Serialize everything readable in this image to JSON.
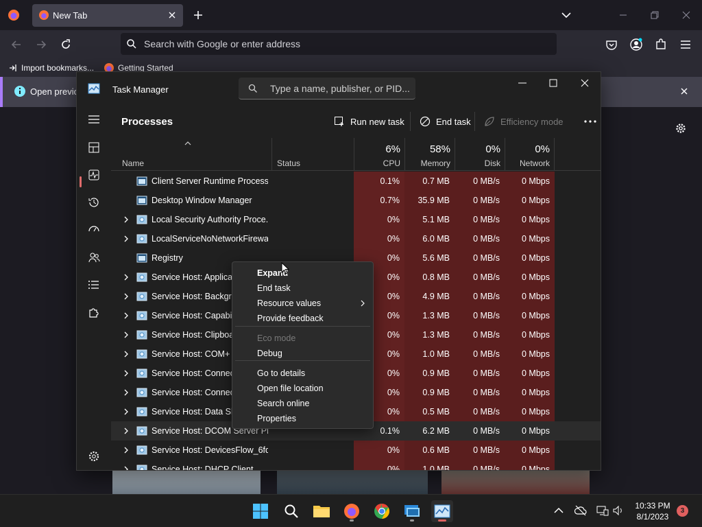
{
  "browser": {
    "tab_title": "New Tab",
    "url_placeholder": "Search with Google or enter address",
    "bookmarks": [
      {
        "label": "Import bookmarks..."
      },
      {
        "label": "Getting Started"
      }
    ],
    "notification_text": "Open previou"
  },
  "task_manager": {
    "window_title": "Task Manager",
    "search_placeholder": "Type a name, publisher, or PID...",
    "page_heading": "Processes",
    "toolbar": {
      "run_new_task": "Run new task",
      "end_task": "End task",
      "efficiency_mode": "Efficiency mode"
    },
    "columns": {
      "name": "Name",
      "status": "Status",
      "cpu": {
        "percent": "6%",
        "label": "CPU"
      },
      "memory": {
        "percent": "58%",
        "label": "Memory"
      },
      "disk": {
        "percent": "0%",
        "label": "Disk"
      },
      "network": {
        "percent": "0%",
        "label": "Network"
      }
    },
    "processes": [
      {
        "name": "Client Server Runtime Process",
        "expandable": false,
        "cpu": "0.1%",
        "memory": "0.7 MB",
        "disk": "0 MB/s",
        "network": "0 Mbps"
      },
      {
        "name": "Desktop Window Manager",
        "expandable": false,
        "cpu": "0.7%",
        "memory": "35.9 MB",
        "disk": "0 MB/s",
        "network": "0 Mbps"
      },
      {
        "name": "Local Security Authority Proce...",
        "expandable": true,
        "cpu": "0%",
        "memory": "5.1 MB",
        "disk": "0 MB/s",
        "network": "0 Mbps"
      },
      {
        "name": "LocalServiceNoNetworkFirewa...",
        "expandable": true,
        "cpu": "0%",
        "memory": "6.0 MB",
        "disk": "0 MB/s",
        "network": "0 Mbps"
      },
      {
        "name": "Registry",
        "expandable": false,
        "cpu": "0%",
        "memory": "5.6 MB",
        "disk": "0 MB/s",
        "network": "0 Mbps"
      },
      {
        "name": "Service Host: Applicati",
        "expandable": true,
        "cpu": "0%",
        "memory": "0.8 MB",
        "disk": "0 MB/s",
        "network": "0 Mbps"
      },
      {
        "name": "Service Host: Backgrou",
        "expandable": true,
        "cpu": "0%",
        "memory": "4.9 MB",
        "disk": "0 MB/s",
        "network": "0 Mbps"
      },
      {
        "name": "Service Host: Capabilit",
        "expandable": true,
        "cpu": "0%",
        "memory": "1.3 MB",
        "disk": "0 MB/s",
        "network": "0 Mbps"
      },
      {
        "name": "Service Host: Clipboar",
        "expandable": true,
        "cpu": "0%",
        "memory": "1.3 MB",
        "disk": "0 MB/s",
        "network": "0 Mbps"
      },
      {
        "name": "Service Host: COM+ E",
        "expandable": true,
        "cpu": "0%",
        "memory": "1.0 MB",
        "disk": "0 MB/s",
        "network": "0 Mbps"
      },
      {
        "name": "Service Host: Connecte",
        "expandable": true,
        "cpu": "0%",
        "memory": "0.9 MB",
        "disk": "0 MB/s",
        "network": "0 Mbps"
      },
      {
        "name": "Service Host: Connecte",
        "expandable": true,
        "cpu": "0%",
        "memory": "0.9 MB",
        "disk": "0 MB/s",
        "network": "0 Mbps"
      },
      {
        "name": "Service Host: Data Sha",
        "expandable": true,
        "cpu": "0%",
        "memory": "0.5 MB",
        "disk": "0 MB/s",
        "network": "0 Mbps"
      },
      {
        "name": "Service Host: DCOM Server Pr...",
        "expandable": true,
        "cpu": "0.1%",
        "memory": "6.2 MB",
        "disk": "0 MB/s",
        "network": "0 Mbps"
      },
      {
        "name": "Service Host: DevicesFlow_6fd...",
        "expandable": true,
        "cpu": "0%",
        "memory": "0.6 MB",
        "disk": "0 MB/s",
        "network": "0 Mbps"
      },
      {
        "name": "Service Host: DHCP Client",
        "expandable": true,
        "cpu": "0%",
        "memory": "1.0 MB",
        "disk": "0 MB/s",
        "network": "0 Mbps"
      }
    ],
    "context_menu": {
      "items": [
        {
          "label": "Expand",
          "bold": true
        },
        {
          "label": "End task"
        },
        {
          "label": "Resource values",
          "submenu": true
        },
        {
          "label": "Provide feedback"
        },
        {
          "label": "Eco mode",
          "disabled": true
        },
        {
          "label": "Debug"
        },
        {
          "label": "Go to details"
        },
        {
          "label": "Open file location"
        },
        {
          "label": "Search online"
        },
        {
          "label": "Properties"
        }
      ]
    }
  },
  "taskbar": {
    "time": "10:33 PM",
    "date": "8/1/2023",
    "notification_count": "3"
  },
  "colors": {
    "accent": "#e0605f",
    "heat_cell": "#5a1e1e",
    "firefox_notification_border": "#a97cf9"
  }
}
